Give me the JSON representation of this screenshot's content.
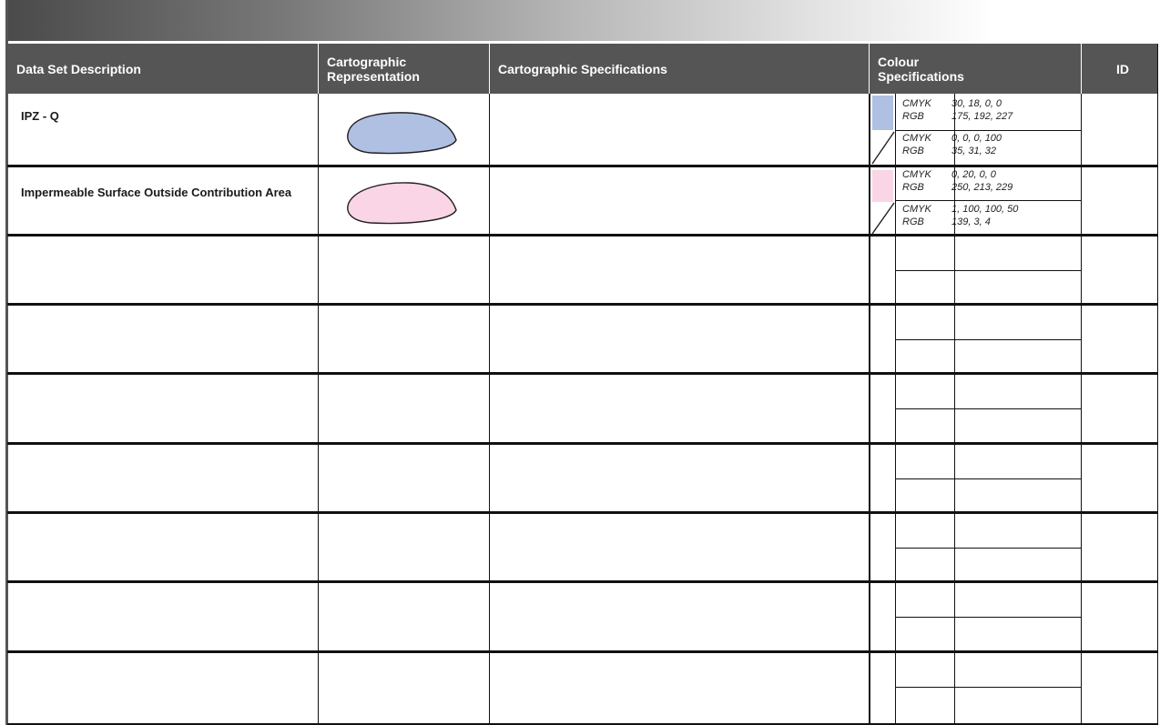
{
  "header": {
    "col_description": "Data Set Description",
    "col_representation": "Cartographic Representation",
    "col_specifications": "Cartographic Specifications",
    "col_colour": "Colour Specifications",
    "col_id": "ID"
  },
  "rows": [
    {
      "description": "IPZ - Q",
      "fill_color": "#afc0e3",
      "outline_color": "#231f20",
      "fill": {
        "model1": "CMYK",
        "model2": "RGB",
        "value1": "30, 18, 0, 0",
        "value2": "175, 192, 227"
      },
      "outline": {
        "model1": "CMYK",
        "model2": "RGB",
        "value1": "0, 0, 0, 100",
        "value2": "35, 31, 32"
      }
    },
    {
      "description": "Impermeable Surface Outside Contribution Area",
      "fill_color": "#fad5e5",
      "outline_color": "#8b0304",
      "fill": {
        "model1": "CMYK",
        "model2": "RGB",
        "value1": "0, 20, 0, 0",
        "value2": "250, 213, 229"
      },
      "outline": {
        "model1": "CMYK",
        "model2": "RGB",
        "value1": "1, 100, 100, 50",
        "value2": "139, 3, 4"
      }
    }
  ]
}
